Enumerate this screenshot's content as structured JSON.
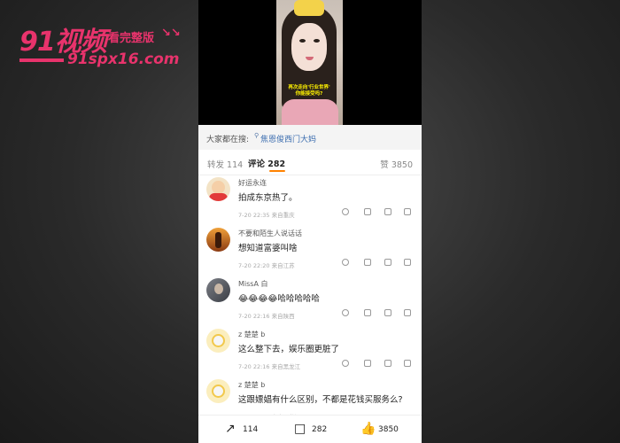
{
  "watermark": {
    "brand": "91视频",
    "tagline": "看完整版",
    "arrows": "↘↘",
    "url": "91spx16.com"
  },
  "video": {
    "caption_line1": "再次走向'行业世界'",
    "caption_line2": "你能接受吗?"
  },
  "search_bar": {
    "label": "大家都在搜:",
    "icon": "search-icon",
    "term": "焦恩俊西门大妈"
  },
  "tabs": {
    "reposts": "转发 114",
    "comments": "评论 282",
    "likes": "赞 3850"
  },
  "comments": [
    {
      "user": "好运永连",
      "text": "拍成东京热了。",
      "meta": "7-20 22:35 来自重庆",
      "avatar": "cartoon-boy-avatar"
    },
    {
      "user": "不要和陌生人说话话",
      "text": "想知道富婆叫啥",
      "meta": "7-20 22:20 来自江苏",
      "avatar": "sunset-hand-avatar"
    },
    {
      "user": "MissA 白",
      "text": "😂😂😂😂哈哈哈哈哈",
      "meta": "7-20 22:16 来自陕西",
      "avatar": "portrait-avatar"
    },
    {
      "user": "z 楚楚 b",
      "text": "这么整下去，娱乐圈更脏了",
      "meta": "7-20 22:16 来自黑龙江",
      "avatar": "flower-avatar"
    },
    {
      "user": "z 楚楚 b",
      "text": "这跟嫖娼有什么区别，不都是花钱买服务么?",
      "meta": "7-20 22:15 来自黑龙江",
      "avatar": "flower-avatar"
    }
  ],
  "bottom_bar": {
    "repost_count": "114",
    "comment_count": "282",
    "like_count": "3850"
  },
  "colors": {
    "accent": "#ff8200",
    "watermark": "#e8336c",
    "link": "#3e6fb0"
  }
}
